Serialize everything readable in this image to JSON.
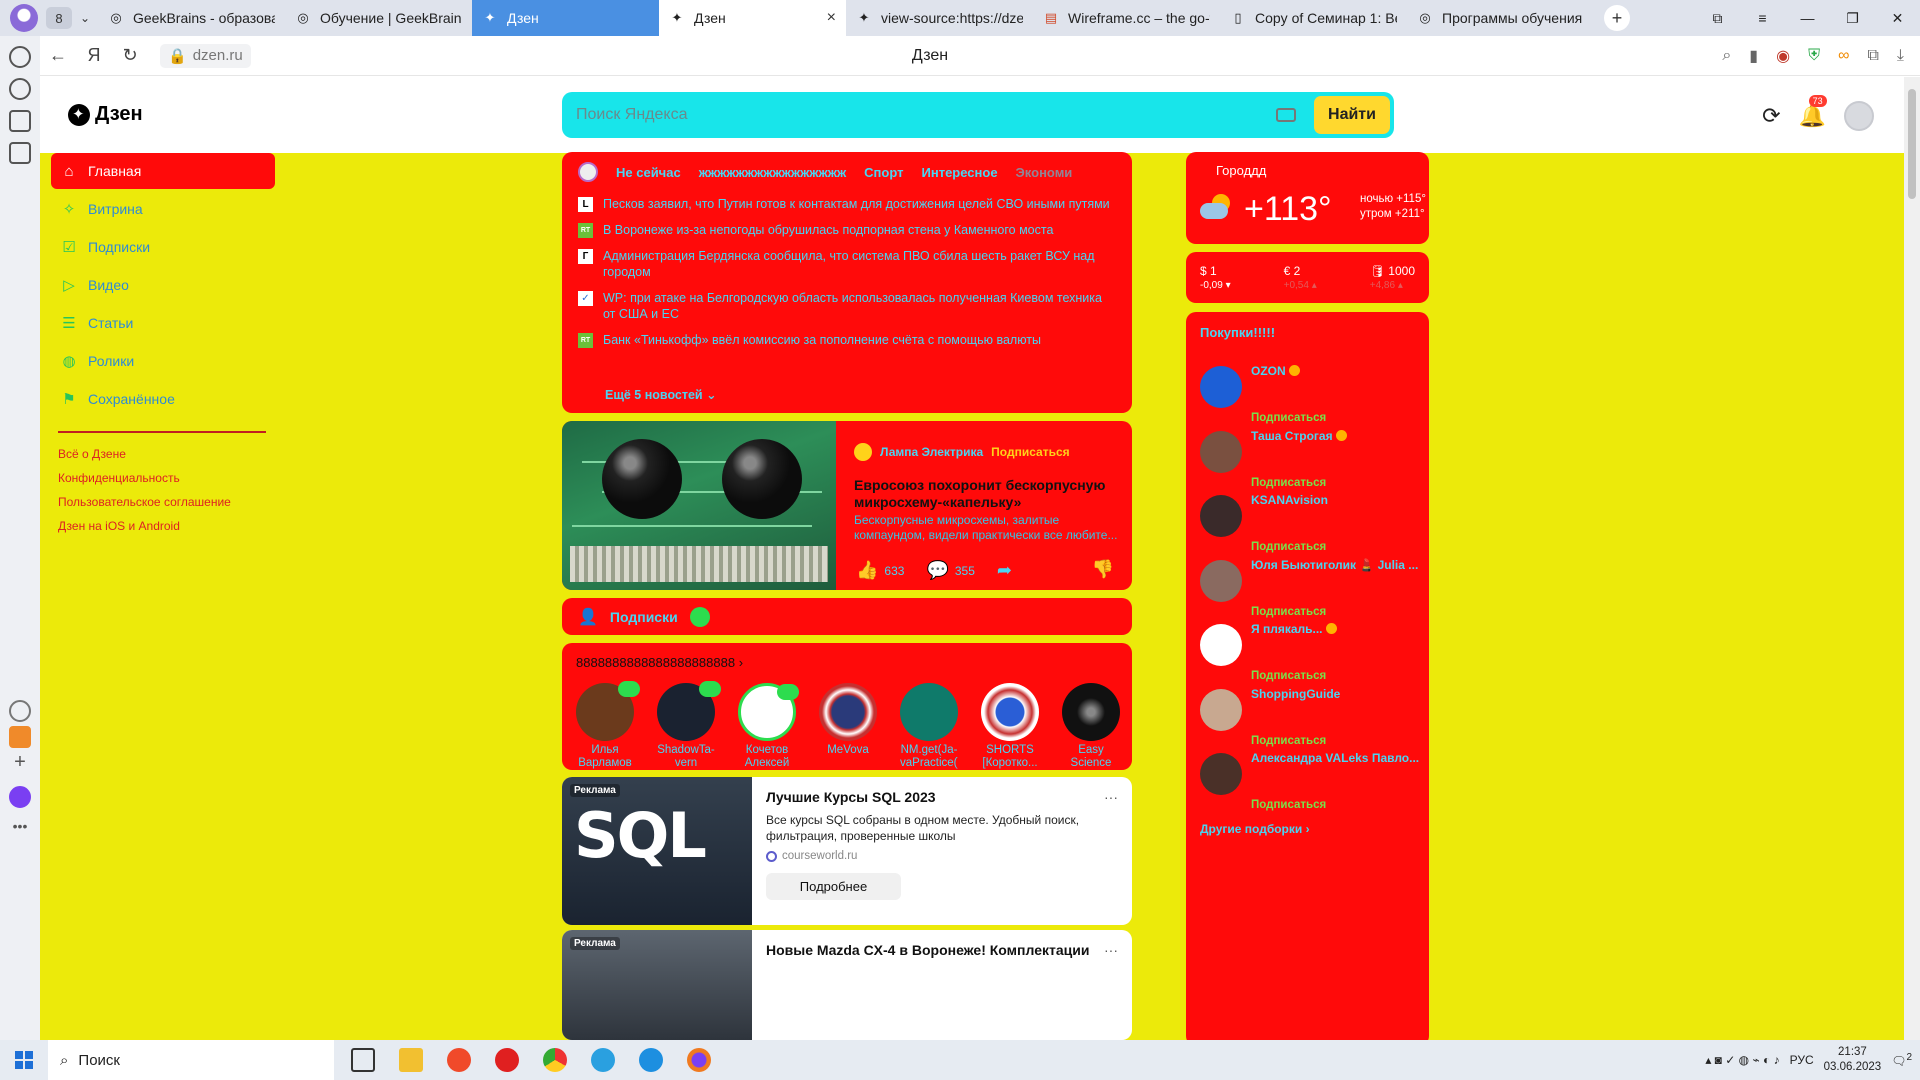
{
  "browser": {
    "tab_count": "8",
    "tabs": [
      {
        "label": "GeekBrains - образоват"
      },
      {
        "label": "Обучение | GeekBrains"
      },
      {
        "label": "Дзен"
      },
      {
        "label": "Дзен"
      },
      {
        "label": "view-source:https://dzen"
      },
      {
        "label": "Wireframe.cc – the go-to"
      },
      {
        "label": "Copy of Семинар 1: Веб"
      },
      {
        "label": "Программы обучения"
      }
    ],
    "url": "dzen.ru",
    "page_title": "Дзен"
  },
  "header": {
    "logo_text": "Дзен",
    "search_placeholder": "Поиск Яндекса",
    "search_button": "Найти",
    "notifications_count": "73"
  },
  "sidebar": {
    "items": [
      {
        "label": "Главная",
        "icon": "home-icon"
      },
      {
        "label": "Витрина",
        "icon": "sparkle-icon"
      },
      {
        "label": "Подписки",
        "icon": "subscriptions-icon"
      },
      {
        "label": "Видео",
        "icon": "video-icon"
      },
      {
        "label": "Статьи",
        "icon": "articles-icon"
      },
      {
        "label": "Ролики",
        "icon": "shorts-icon"
      },
      {
        "label": "Сохранённое",
        "icon": "bookmark-icon"
      }
    ],
    "links": [
      "Всё о Дзене",
      "Конфиденциальность",
      "Пользовательское соглашение",
      "Дзен на iOS и Android"
    ]
  },
  "news": {
    "tabs": [
      "Не сейчас",
      "жжжжжжжжжжжжжжжж",
      "Спорт",
      "Интересное",
      "Экономи"
    ],
    "items": [
      {
        "src": "L",
        "text": "Песков заявил, что Путин готов к контактам для достижения целей СВО иными путями"
      },
      {
        "src": "RT",
        "text": "В Воронеже из-за непогоды обрушилась подпорная стена у Каменного моста"
      },
      {
        "src": "Г",
        "text": "Администрация Бердянска сообщила, что система ПВО сбила шесть ракет ВСУ над городом"
      },
      {
        "src": "✓",
        "text": "WP: при атаке на Белгородскую область использовалась полученная Киевом техника от США и ЕС"
      },
      {
        "src": "RT",
        "text": "Банк «Тинькофф» ввёл комиссию за пополнение счёта с помощью валюты"
      }
    ],
    "more": "Ещё 5 новостей"
  },
  "article": {
    "author": "Лампа Электрика",
    "subscribe": "Подписаться",
    "title": "Евросоюз похоронит бескорпусную микросхему-«капельку»",
    "desc": "Бескорпусные микросхемы, залитые компаундом, видели практически все любите...",
    "likes": "633",
    "comments": "355"
  },
  "subs": {
    "bar_label": "Подписки",
    "grid_title": "8888888888888888888888",
    "channels": [
      {
        "name": "Илья Варламов",
        "color": "#6b3a1c"
      },
      {
        "name": "ShadowTa-vern",
        "color": "#1a2230"
      },
      {
        "name": "Кочетов Алексей",
        "color": "#ffffff"
      },
      {
        "name": "MeVova",
        "color": "#c63030"
      },
      {
        "name": "NM.get(Ja-vaPractice();",
        "color": "#0f7a6a"
      },
      {
        "name": "SHORTS [Коротко...",
        "color": "#ffffff"
      },
      {
        "name": "Easy Science",
        "color": "#111111"
      }
    ]
  },
  "ads": [
    {
      "tag": "Реклама",
      "title": "Лучшие Курсы SQL 2023",
      "desc": "Все курсы SQL собраны в одном месте. Удобный поиск, фильтрация, проверенные школы",
      "src": "courseworld.ru",
      "button": "Подробнее",
      "img_text": "SQL"
    },
    {
      "tag": "Реклама",
      "title": "Новые Mazda CX-4 в Воронеже! Комплектации"
    }
  ],
  "weather": {
    "city": "Городдд",
    "temp": "+113°",
    "night": "ночью +115°",
    "morning": "утром +211°"
  },
  "rates": [
    {
      "label": "$ 1",
      "delta": "-0,09 ▾"
    },
    {
      "label": "€ 2",
      "delta": "+0,54 ▴"
    },
    {
      "label": "🛢 1000",
      "delta": "+4,86 ▴"
    }
  ],
  "shop": {
    "title": "Покупки!!!!!",
    "items": [
      {
        "name": "OZON",
        "verified": true,
        "color": "#1d5fd6"
      },
      {
        "name": "Таша Строгая",
        "verified": true,
        "color": "#7a5040"
      },
      {
        "name": "KSANAvision",
        "verified": false,
        "color": "#3a2a2a"
      },
      {
        "name": "Юля Быютиголик 💄 Julia ...",
        "verified": false,
        "color": "#8a6a60"
      },
      {
        "name": "Я плякаль...",
        "verified": true,
        "color": "#ffffff"
      },
      {
        "name": "ShoppingGuide",
        "verified": false,
        "color": "#c8a890"
      },
      {
        "name": "Александра VALeks Павло...",
        "verified": false,
        "color": "#4a3028"
      }
    ],
    "subscribe": "Подписаться",
    "other": "Другие подборки"
  },
  "taskbar": {
    "search": "Поиск",
    "lang": "РУС",
    "time": "21:37",
    "date": "03.06.2023",
    "notif": "2"
  }
}
